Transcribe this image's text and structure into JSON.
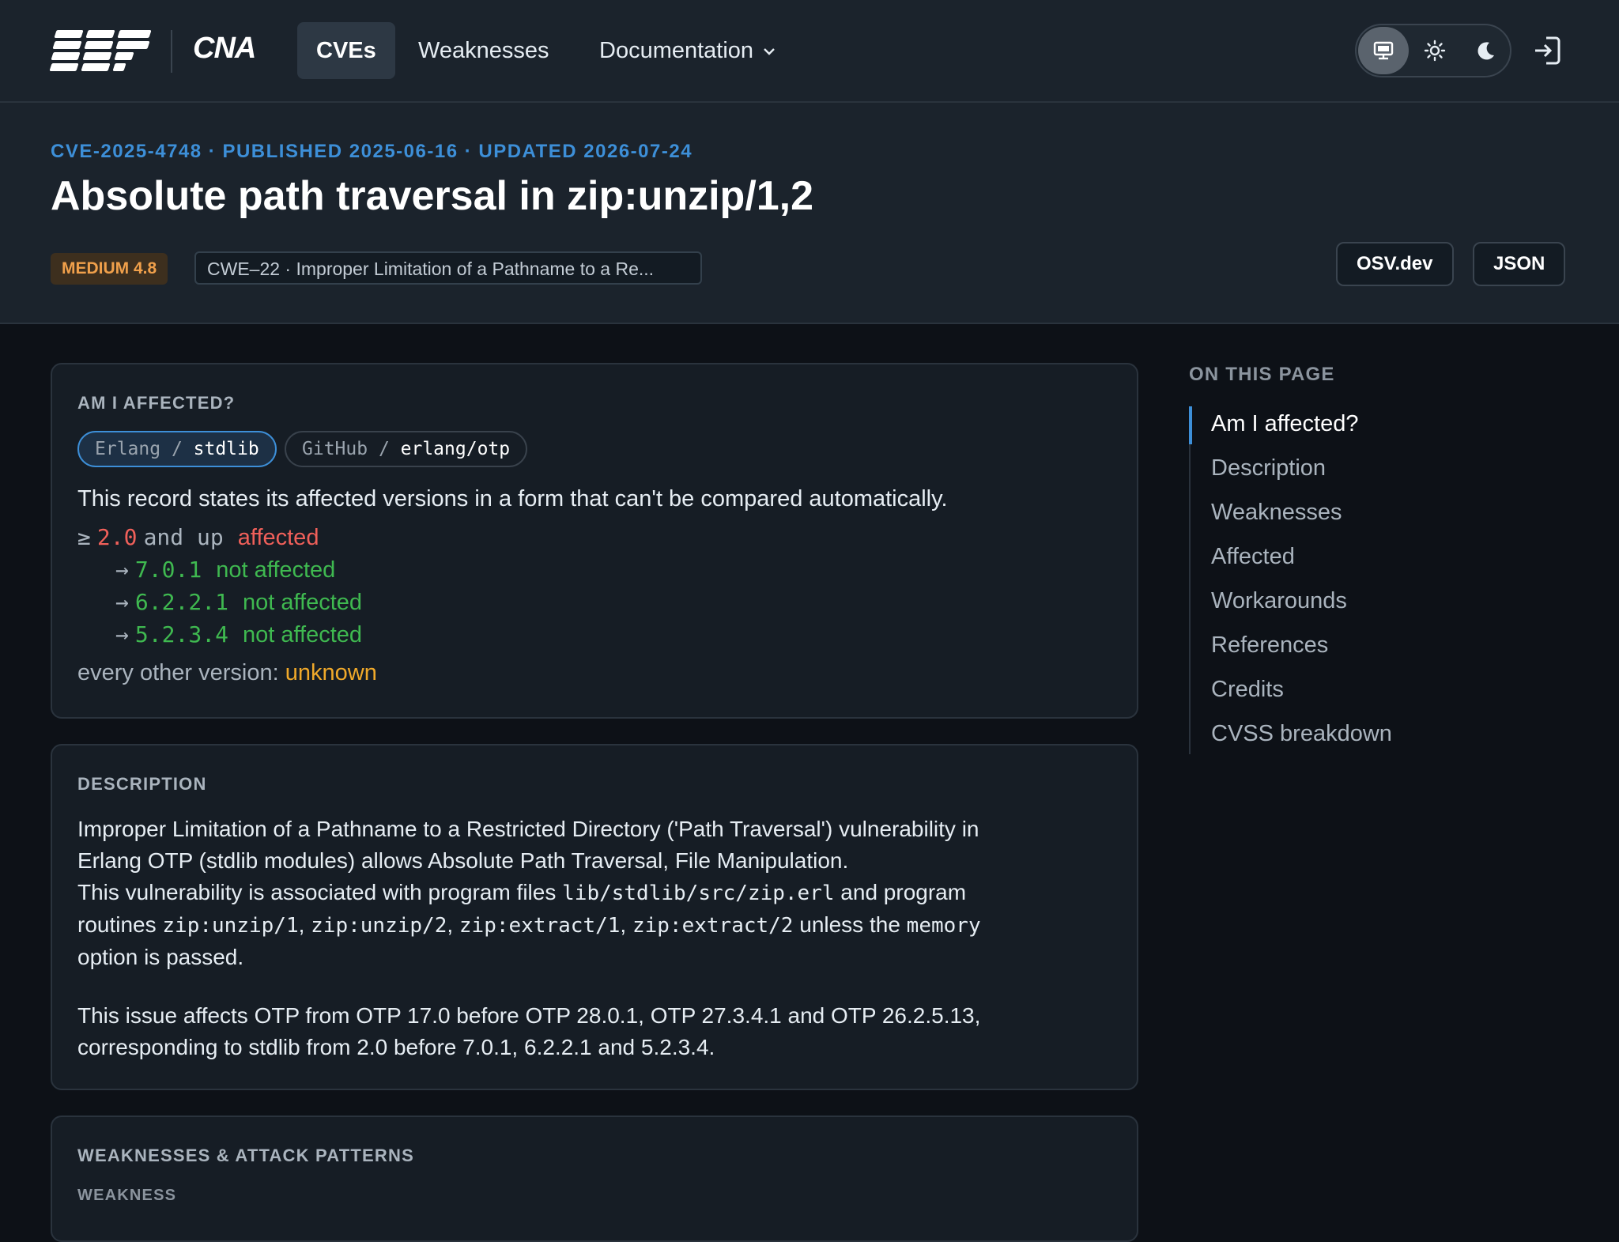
{
  "nav": {
    "brand": "CNA",
    "items": [
      {
        "label": "CVEs",
        "active": true
      },
      {
        "label": "Weaknesses"
      },
      {
        "label": "Documentation"
      }
    ],
    "theme_options": [
      "monitor-icon",
      "sun-icon",
      "moon-icon"
    ],
    "selected_theme": "monitor-icon",
    "login_icon": "login-icon"
  },
  "header": {
    "meta": "CVE-2025-4748 · PUBLISHED 2025-06-16 · UPDATED 2026-07-24",
    "title": "Absolute path traversal in zip:unzip/1,2",
    "severity": "MEDIUM 4.8",
    "cwe": "CWE–22 · Improper Limitation of a Pathname to a Re...",
    "buttons": {
      "osv": "OSV.dev",
      "json": "JSON"
    }
  },
  "affected": {
    "heading": "AM I AFFECTED?",
    "packages": [
      {
        "ecosystem": "Erlang",
        "sep": " / ",
        "name": "stdlib",
        "selected": true
      },
      {
        "ecosystem": "GitHub",
        "sep": " / ",
        "name": "erlang/otp",
        "selected": false
      }
    ],
    "note": "This record states its affected versions in a form that can't be compared automatically.",
    "range": {
      "prefix": "≥",
      "version": "2.0",
      "suffix": "and up",
      "status": "affected"
    },
    "fixes": [
      {
        "arrow": "→",
        "version": "7.0.1",
        "status": "not affected"
      },
      {
        "arrow": "→",
        "version": "6.2.2.1",
        "status": "not affected"
      },
      {
        "arrow": "→",
        "version": "5.2.3.4",
        "status": "not affected"
      }
    ],
    "other_label": "every other version:",
    "other_status": "unknown"
  },
  "description": {
    "heading": "DESCRIPTION",
    "line1": "Improper Limitation of a Pathname to a Restricted Directory ('Path Traversal') vulnerability in",
    "line2": "Erlang OTP (stdlib modules) allows Absolute Path Traversal, File Manipulation.",
    "line3_pre": "This vulnerability is associated with program files ",
    "line3_code": "lib/stdlib/src/zip.erl",
    "line3_post": " and program",
    "line4_pre": "routines ",
    "line4_code1": "zip:unzip/1",
    "line4_code2": "zip:unzip/2",
    "line4_code3": "zip:extract/1",
    "line4_code4": "zip:extract/2",
    "line4_post": " unless the ",
    "line4_code5": "memory",
    "line5": "option is passed.",
    "para2_line1": "This issue affects OTP from OTP 17.0 before OTP 28.0.1, OTP 27.3.4.1 and OTP 26.2.5.13,",
    "para2_line2": "corresponding to stdlib from 2.0 before 7.0.1, 6.2.2.1 and 5.2.3.4."
  },
  "weaknesses": {
    "heading": "WEAKNESSES & ATTACK PATTERNS",
    "sub": "WEAKNESS"
  },
  "toc": {
    "heading": "ON THIS PAGE",
    "items": [
      "Am I affected?",
      "Description",
      "Weaknesses",
      "Affected",
      "Workarounds",
      "References",
      "Credits",
      "CVSS breakdown"
    ],
    "active_index": 0
  }
}
